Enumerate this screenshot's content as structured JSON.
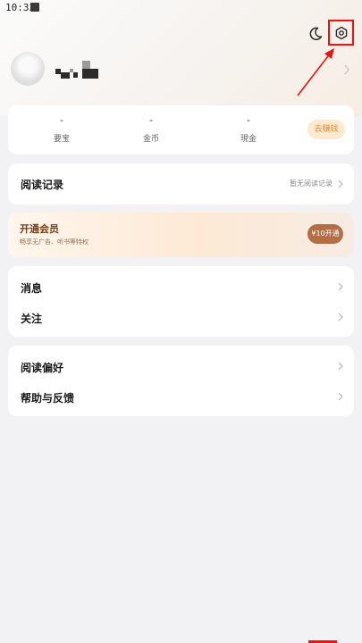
{
  "status_bar": {
    "time": "10:33"
  },
  "header": {
    "moon_icon": "moon-icon",
    "settings_icon": "gear-icon",
    "highlight_color": "#e11111"
  },
  "profile": {
    "avatar_icon": "avatar"
  },
  "stats": {
    "items": [
      {
        "value": "-",
        "label": "要宝"
      },
      {
        "value": "-",
        "label": "金币"
      },
      {
        "value": "-",
        "label": "現金"
      }
    ],
    "earn_button": "去赚钱"
  },
  "reading_history": {
    "title": "阅读记录",
    "note": "暂无阅读记录"
  },
  "vip": {
    "title": "开通会员",
    "subtitle": "畅享无广告、听书等特权",
    "button": "¥10开通",
    "accent": "#b46e45"
  },
  "menu_group_1": {
    "items": [
      {
        "label": "消息"
      },
      {
        "label": "关注"
      }
    ]
  },
  "menu_group_2": {
    "items": [
      {
        "label": "阅读偏好"
      },
      {
        "label": "帮助与反馈"
      }
    ]
  }
}
